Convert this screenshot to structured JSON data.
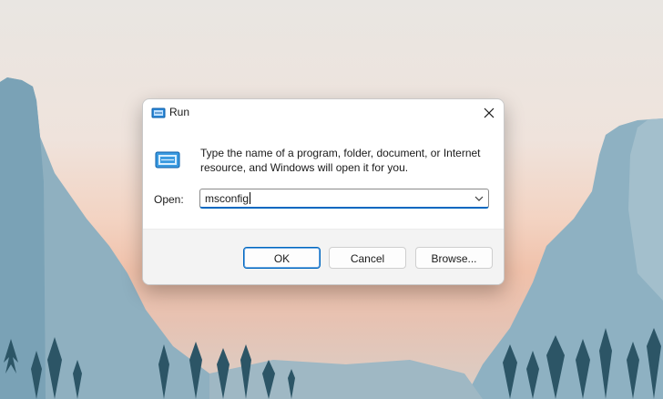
{
  "window": {
    "title": "Run",
    "description": "Type the name of a program, folder, document, or Internet resource, and Windows will open it for you.",
    "open_label": "Open:",
    "open_value": "msconfig"
  },
  "buttons": {
    "ok": "OK",
    "cancel": "Cancel",
    "browse": "Browse..."
  },
  "icons": {
    "title": "run-icon",
    "body": "run-icon",
    "close": "close-icon",
    "dropdown": "chevron-down-icon"
  },
  "colors": {
    "accent": "#0067c0",
    "dialog_bg": "#ffffff",
    "button_bar_bg": "#f3f3f3"
  }
}
